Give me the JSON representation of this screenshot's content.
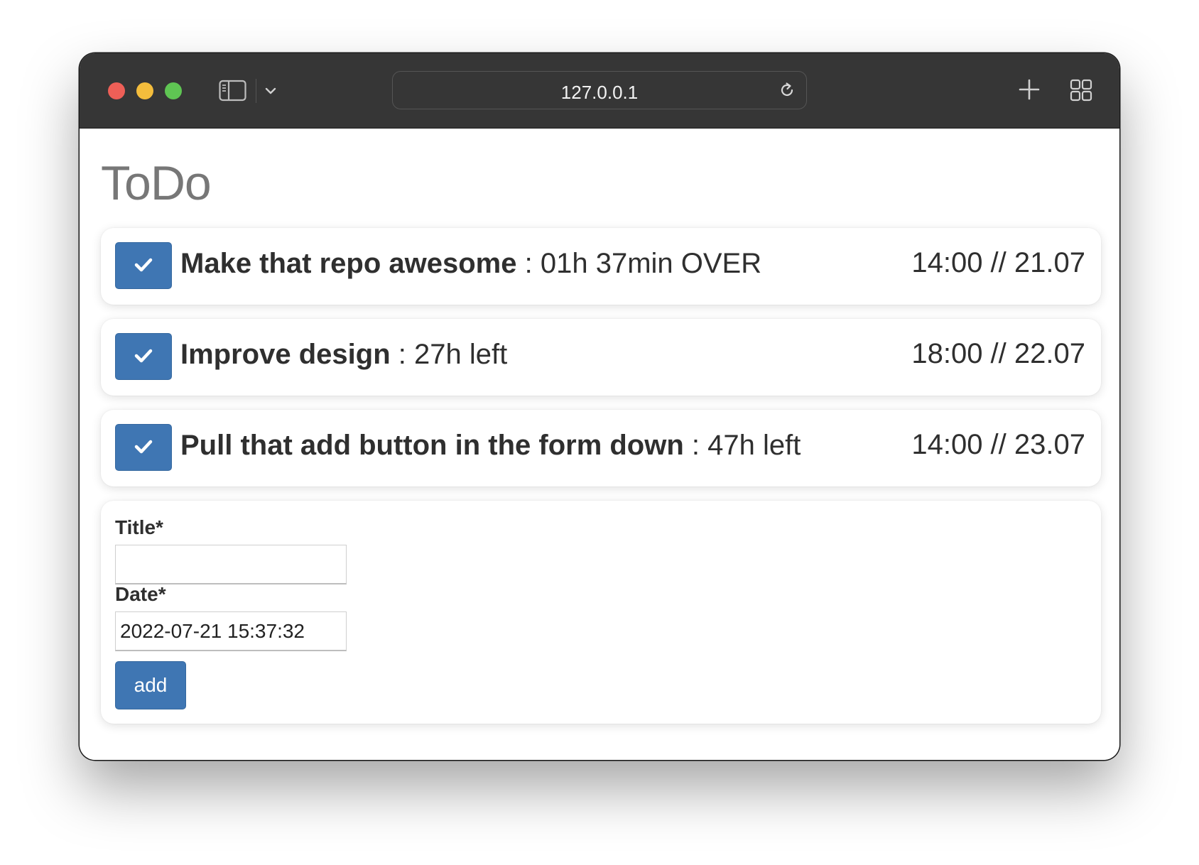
{
  "browser": {
    "url": "127.0.0.1"
  },
  "page": {
    "title": "ToDo"
  },
  "todos": [
    {
      "title": "Make that repo awesome",
      "separator": " : ",
      "status": "01h 37min OVER",
      "due": "14:00 // 21.07",
      "done": false
    },
    {
      "title": "Improve design",
      "separator": " : ",
      "status": "27h left",
      "due": "18:00 // 22.07",
      "done": false
    },
    {
      "title": "Pull that add button in the form down",
      "separator": " : ",
      "status": "47h left",
      "due": "14:00 // 23.07",
      "done": false
    }
  ],
  "form": {
    "title_label": "Title*",
    "title_value": "",
    "date_label": "Date*",
    "date_value": "2022-07-21 15:37:32",
    "add_label": "add"
  },
  "colors": {
    "accent": "#3f76b3",
    "titlebar": "#363636",
    "text": "#2f2f2f",
    "heading": "#777777"
  },
  "icons": {
    "check": "check-icon",
    "sidebar": "sidebar-icon",
    "chevron": "chevron-down-icon",
    "reload": "reload-icon",
    "plus": "plus-icon",
    "tabs": "tab-overview-icon"
  }
}
